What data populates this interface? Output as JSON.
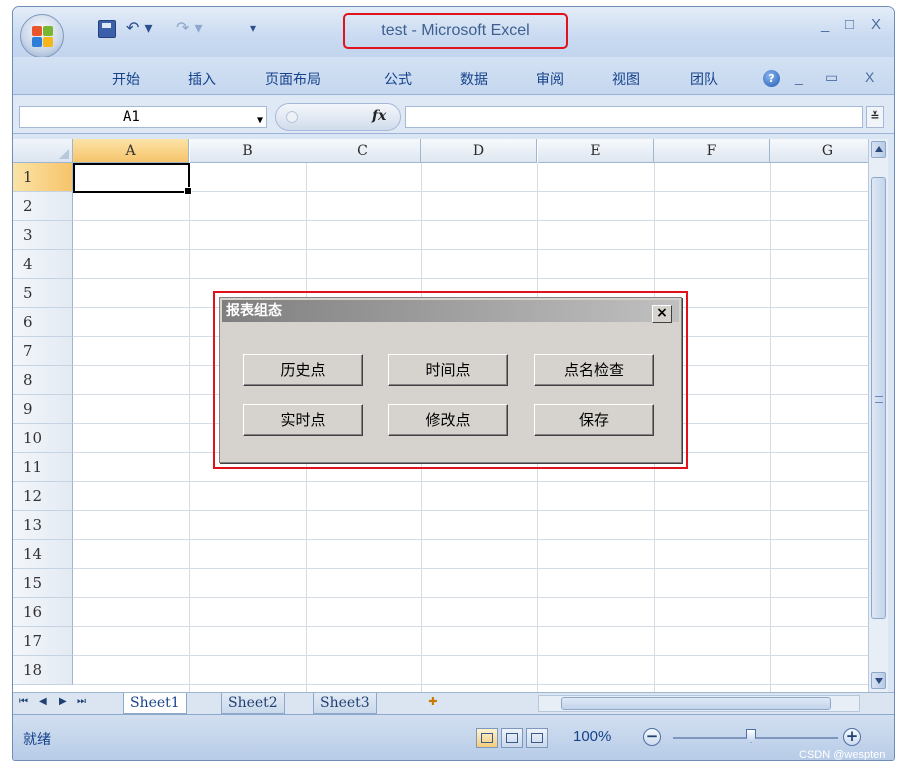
{
  "window": {
    "title": "test - Microsoft Excel",
    "minimize": "_",
    "maximize": "□",
    "close": "X"
  },
  "quick_access": {
    "undo": "↶ ▾",
    "redo": "↷ ▾",
    "customize": "▾"
  },
  "ribbon": {
    "tabs": [
      "开始",
      "插入",
      "页面布局",
      "公式",
      "数据",
      "审阅",
      "视图",
      "团队"
    ],
    "help": "?",
    "minimize": "_",
    "restore": "▭",
    "close": "X"
  },
  "formula_bar": {
    "name_box": "A1",
    "fx": "fx",
    "value": "",
    "expand": "≚"
  },
  "grid": {
    "columns": [
      "A",
      "B",
      "C",
      "D",
      "E",
      "F",
      "G"
    ],
    "rows": [
      "1",
      "2",
      "3",
      "4",
      "5",
      "6",
      "7",
      "8",
      "9",
      "10",
      "11",
      "12",
      "13",
      "14",
      "15",
      "16",
      "17",
      "18"
    ],
    "active_cell": "A1"
  },
  "sheet_tabs": {
    "nav": [
      "⏮",
      "◀",
      "▶",
      "⏭"
    ],
    "sheets": [
      "Sheet1",
      "Sheet2",
      "Sheet3"
    ],
    "active": "Sheet1"
  },
  "status_bar": {
    "status": "就绪",
    "zoom": "100%",
    "zoom_minus": "−",
    "zoom_plus": "+"
  },
  "watermark": "CSDN @wespten",
  "dialog": {
    "title": "报表组态",
    "close": "×",
    "buttons": [
      "历史点",
      "时间点",
      "点名检查",
      "实时点",
      "修改点",
      "保存"
    ]
  },
  "colors": {
    "highlight_red": "#e1121b",
    "selected_header": "#f6c46b",
    "ribbon_blue": "#c5d7ef"
  }
}
